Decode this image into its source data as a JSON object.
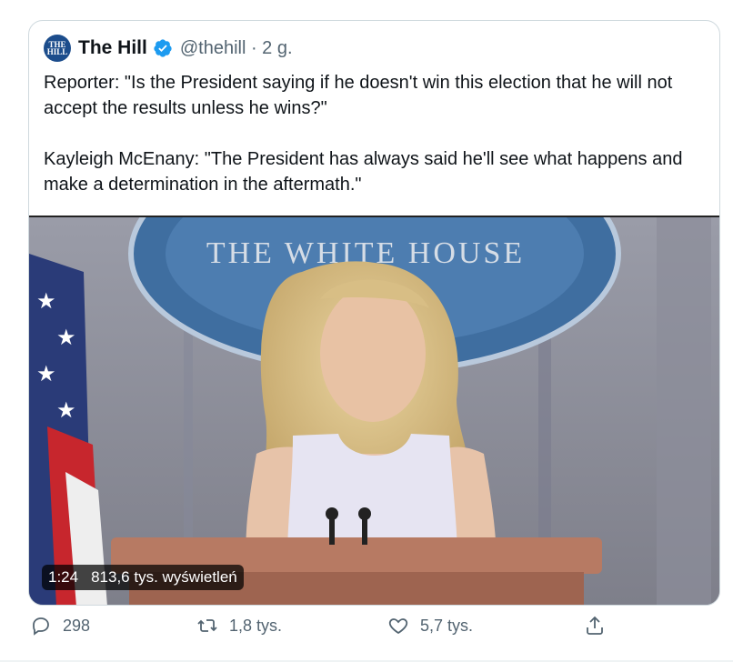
{
  "quote": {
    "avatar_text": "THE HILL",
    "author_name": "The Hill",
    "handle_time": "@thehill · 2 g.",
    "text": "Reporter: \"Is the President saying if he doesn't win this election that he will not accept the results unless he wins?\"\n\nKayleigh McEnany: \"The President has always said he'll see what happens and make a determination in the aftermath.\""
  },
  "video": {
    "duration": "1:24",
    "views": "813,6 tys. wyświetleń",
    "seal_text": "THE WHITE HOUSE"
  },
  "actions": {
    "reply_count": "298",
    "retweet_count": "1,8 tys.",
    "like_count": "5,7 tys."
  },
  "colors": {
    "verified": "#1d9bf0",
    "secondary_text": "#536471",
    "border": "#cfd9de"
  }
}
